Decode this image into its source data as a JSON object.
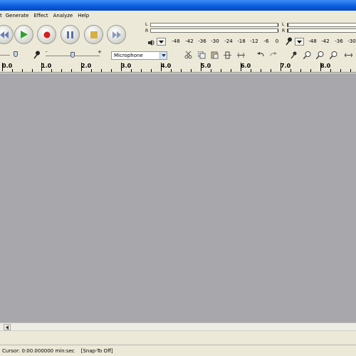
{
  "menu": {
    "items": [
      "t",
      "Generate",
      "Effect",
      "Analyze",
      "Help"
    ]
  },
  "transport": {
    "icons": [
      "skip-to-start-icon",
      "play-icon",
      "record-icon",
      "pause-icon",
      "stop-icon",
      "skip-to-end-icon"
    ]
  },
  "meters": {
    "playback": {
      "left_label": "L",
      "right_label": "R",
      "scale": [
        "-48",
        "-42",
        "-36",
        "-30",
        "-24",
        "-18",
        "-12",
        "-6",
        "0"
      ]
    },
    "record": {
      "left_label": "L",
      "right_label": "R",
      "scale": [
        "-48",
        "-42",
        "-36",
        "-30"
      ]
    }
  },
  "mixer": {
    "input_source": "Microphone",
    "minus": "-",
    "plus": "+"
  },
  "ruler": {
    "labels": [
      "0.0",
      "1.0",
      "2.0",
      "3.0",
      "4.0",
      "5.0",
      "6.0",
      "7.0",
      "8.0"
    ]
  },
  "status": {
    "cursor": "Cursor: 0:00.000000 min:sec",
    "snap": "[Snap-To Off]"
  }
}
